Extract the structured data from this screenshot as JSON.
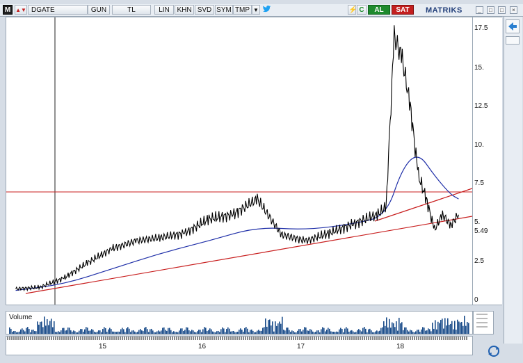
{
  "toolbar": {
    "m_label": "M",
    "symbol": "DGATE",
    "period": "GUN",
    "currency": "TL",
    "scale": "LIN",
    "btn_khn": "KHN",
    "btn_svd": "SVD",
    "btn_sym": "SYM",
    "btn_tmp": "TMP",
    "buy": "AL",
    "sell": "SAT",
    "brand": "MATRIKS"
  },
  "y_axis": {
    "ticks": [
      "17.5",
      "15.",
      "12.5",
      "10.",
      "7.5",
      "5.49",
      "5.",
      "2.5",
      "0"
    ],
    "last_price": "5.49"
  },
  "x_axis": {
    "years": [
      "15",
      "16",
      "17",
      "18"
    ]
  },
  "volume": {
    "label": "Volume",
    "color": "#1a4c8a"
  },
  "colors": {
    "price": "#000000",
    "moving_average": "#1f2fa8",
    "trend_lines": "#c81e1e",
    "horizontal_line": "#c81e1e"
  },
  "chart_data": {
    "type": "line",
    "series": [
      {
        "x": [
          "2014-02",
          "2014-05",
          "2014-08",
          "2014-11",
          "2015-02",
          "2015-05",
          "2015-08",
          "2015-11",
          "2016-02",
          "2016-05",
          "2016-08",
          "2016-11",
          "2017-02",
          "2017-05",
          "2017-08",
          "2017-11",
          "2017-12",
          "2018-01",
          "2018-02",
          "2018-03",
          "2018-04",
          "2018-05",
          "2018-06",
          "2018-07",
          "2018-08",
          "2018-09"
        ],
        "values": [
          0.7,
          0.8,
          1.4,
          2.4,
          3.3,
          3.8,
          4.0,
          4.3,
          5.2,
          5.5,
          6.5,
          4.2,
          3.8,
          4.3,
          4.9,
          5.5,
          6.0,
          17.0,
          15.5,
          12.5,
          8.0,
          6.5,
          4.5,
          5.5,
          4.8,
          5.49
        ]
      },
      {
        "x": [
          "2014-02",
          "2014-08",
          "2015-02",
          "2015-08",
          "2016-02",
          "2016-08",
          "2017-02",
          "2017-08",
          "2017-12",
          "2018-02",
          "2018-04",
          "2018-06",
          "2018-08",
          "2018-09"
        ],
        "values": [
          0.6,
          1.0,
          2.0,
          3.0,
          3.8,
          4.7,
          4.5,
          4.9,
          5.4,
          8.5,
          9.5,
          8.0,
          6.8,
          6.5
        ]
      }
    ],
    "ylim": [
      0,
      18
    ],
    "grid": false
  }
}
